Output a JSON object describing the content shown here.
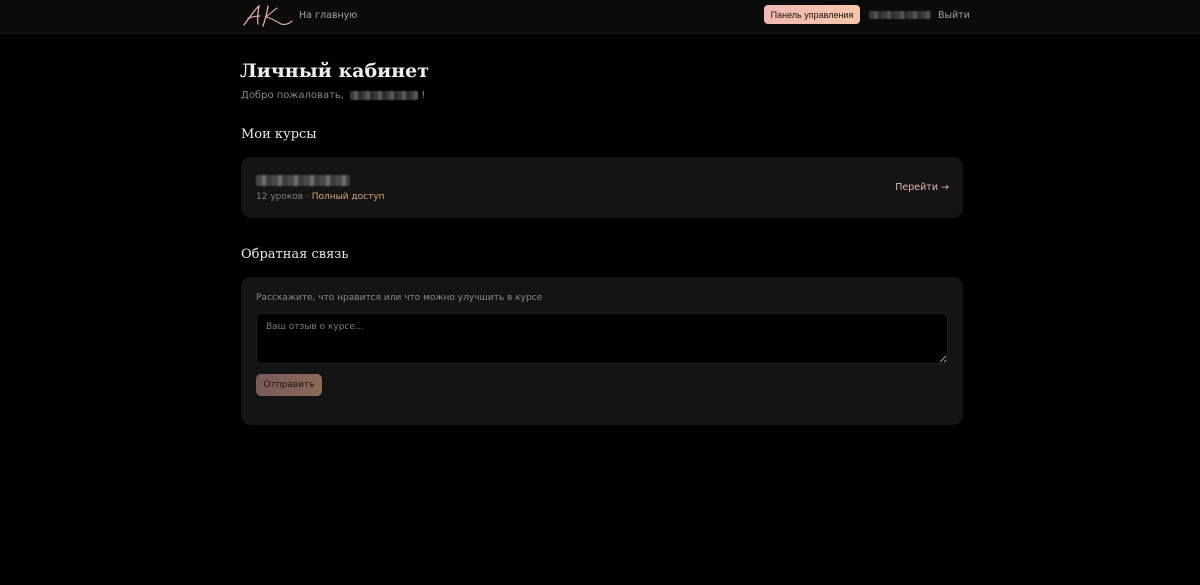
{
  "header": {
    "logo_text": "AK",
    "home_label": "На главную",
    "dashboard_label": "Панель управления",
    "logout_label": "Выйти"
  },
  "main": {
    "title": "Личный кабинет",
    "welcome_prefix": "Добро пожаловать,",
    "welcome_suffix": "!"
  },
  "courses": {
    "section_title": "Мои курсы",
    "items": [
      {
        "lessons_text": "12 уроков · ",
        "access_text": "Полный доступ",
        "go_label": "Перейти →"
      }
    ]
  },
  "feedback": {
    "section_title": "Обратная связь",
    "hint": "Расскажите, что нравится или что можно улучшить в курсе",
    "placeholder": "Ваш отзыв о курсе...",
    "value": "",
    "submit_label": "Отправить"
  },
  "colors": {
    "accent_pink": "#f2b8b5",
    "accent_gold": "#d9a57a",
    "background": "#000000",
    "card": "#141414"
  }
}
